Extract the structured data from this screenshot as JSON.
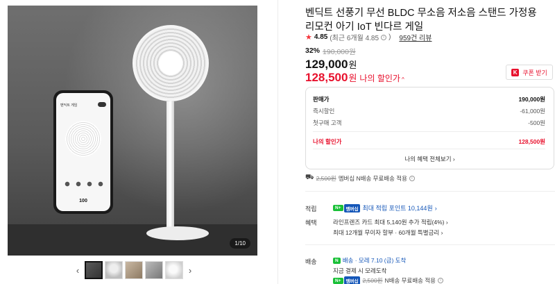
{
  "gallery": {
    "pager": "1/10",
    "phone_title": "벤딕트 게임",
    "phone_speed": "100",
    "prev_arrow": "‹",
    "next_arrow": "›"
  },
  "product": {
    "title": "벤딕트 선풍기 무선 BLDC 무소음 저소음 스탠드 가정용 리모컨 아기 IoT 빈다르 게일",
    "rating": "4.85",
    "rating_sub": "(최근 6개월 4.85",
    "review_link": "959건 리뷰",
    "discount_rate": "32%",
    "original_price": "190,000원",
    "price": "129,000",
    "price_unit": "원",
    "my_price": "128,500",
    "my_price_unit": "원",
    "my_price_label": "나의 할인가",
    "coupon_label": "쿠폰 받기",
    "coupon_icon_text": "K"
  },
  "breakdown": {
    "head_label": "판매가",
    "head_value": "190,000원",
    "r1_label": "즉시할인",
    "r1_value": "-61,000원",
    "r2_label": "첫구매 고객",
    "r2_value": "-500원",
    "mine_label": "나의 할인가",
    "mine_value": "128,500원",
    "more_label": "나의 혜택 전체보기"
  },
  "shipping_top": {
    "fee_strike": "2,500원",
    "text": "멤버십 N배송 무료배송 적용"
  },
  "points": {
    "label": "적립",
    "badge_n": "N+",
    "badge_m": "멤버십",
    "text": "최대 적립 포인트 10,144원"
  },
  "benefit": {
    "label": "혜택",
    "line1": "라인프렌즈 카드 최대 5,140원 추가 적립(4%)",
    "line2": "최대 12개월 무이자 할부 · 60개월 특별금리"
  },
  "delivery": {
    "label": "배송",
    "n_badge": "N",
    "line1": "배송 · 모레 7.10 (금) 도착",
    "line2": "지금 결제 시 모레도착",
    "fee_strike": "2,500원",
    "line3": "N배송 무료배송 적용"
  },
  "colors": {
    "accent_red": "#e8112d",
    "link_blue": "#1456b8",
    "naver_green": "#19c037"
  }
}
